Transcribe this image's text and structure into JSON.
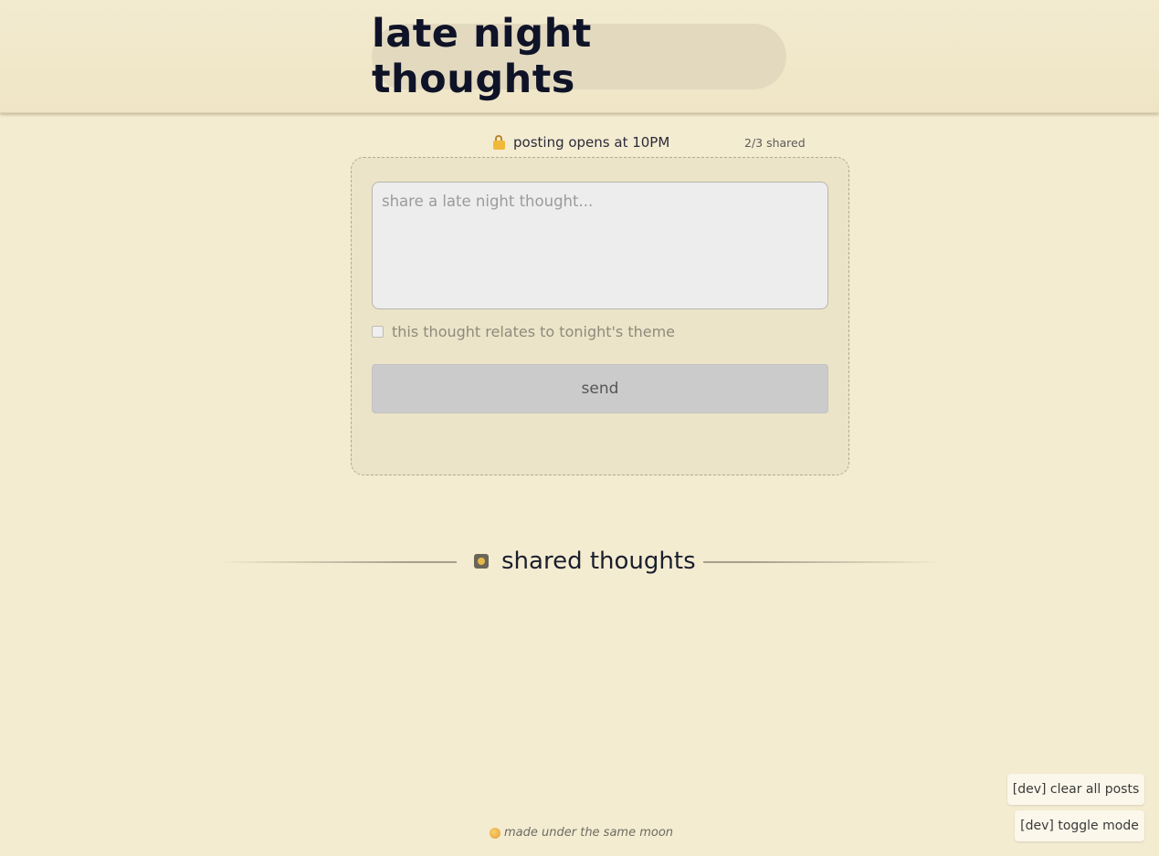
{
  "header": {
    "title": "late night thoughts"
  },
  "composer": {
    "status_text": "posting opens at 10PM",
    "shared_count": "2/3 shared",
    "input_placeholder": "share a late night thought...",
    "input_value": "",
    "theme_checkbox_label": "this thought relates to tonight's theme",
    "theme_checked": false,
    "send_label": "send"
  },
  "feed": {
    "heading": "shared thoughts"
  },
  "footer": {
    "text": "made under the same moon"
  },
  "dev": {
    "clear_label": "[dev] clear all posts",
    "toggle_label": "[dev] toggle mode"
  },
  "icons": {
    "status": "lock-icon",
    "feed": "moon-picture-icon",
    "footer": "moon-icon"
  },
  "colors": {
    "background": "#f4ecd1",
    "title_pill": "#e2d9bf",
    "card": "#ebe4c8",
    "send_disabled": "#cbcbcb"
  }
}
